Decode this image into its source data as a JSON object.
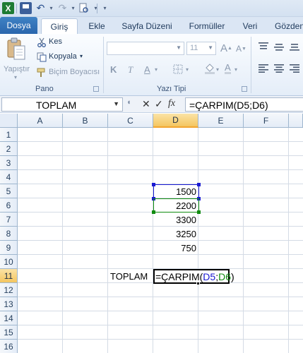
{
  "qat": {
    "app_icon": "excel-logo-icon",
    "logo_letter": "X",
    "icons": [
      "save-icon",
      "undo-icon",
      "redo-icon",
      "print-preview-icon",
      "customize-icon"
    ]
  },
  "tabs": {
    "file": "Dosya",
    "items": [
      "Giriş",
      "Ekle",
      "Sayfa Düzeni",
      "Formüller",
      "Veri",
      "Gözden"
    ]
  },
  "ribbon": {
    "clipboard": {
      "paste": "Yapıştır",
      "cut": "Kes",
      "copy": "Kopyala",
      "format_painter": "Biçim Boyacısı",
      "group_label": "Pano"
    },
    "font": {
      "font_name": "",
      "font_size": "11",
      "bold": "K",
      "italic": "T",
      "underline": "A",
      "group_label": "Yazı Tipi"
    }
  },
  "formula_bar": {
    "name_box": "TOPLAM",
    "cancel_icon": "✕",
    "enter_icon": "✓",
    "function_icon": "fx",
    "formula": "=ÇARPIM(D5;D6)"
  },
  "sheet": {
    "columns": [
      "A",
      "B",
      "C",
      "D",
      "E",
      "F"
    ],
    "rows": [
      "1",
      "2",
      "3",
      "4",
      "5",
      "6",
      "7",
      "8",
      "9",
      "10",
      "11",
      "12",
      "13",
      "14",
      "15",
      "16"
    ],
    "cells": {
      "D5": "1500",
      "D6": "2200",
      "D7": "3300",
      "D8": "3250",
      "D9": "750",
      "C11": "TOPLAM"
    },
    "edit": {
      "prefix": "=ÇARPIM(",
      "ref1": "D5",
      "separator": ";",
      "ref2": "D6",
      "suffix": ")"
    }
  },
  "colors": {
    "ref1": "#1a1ad2",
    "ref2": "#108c10",
    "selected_header": "#f4c660",
    "file_tab": "#2a66ad"
  }
}
